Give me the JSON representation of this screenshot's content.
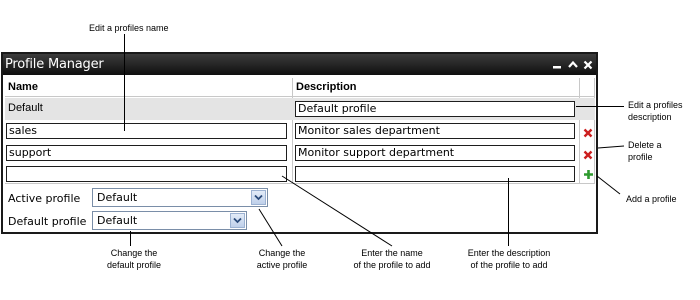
{
  "annotations": {
    "edit_name": "Edit a profiles name",
    "edit_desc_1": "Edit a profiles",
    "edit_desc_2": "description",
    "delete_1": "Delete a",
    "delete_2": "profile",
    "add": "Add a profile",
    "change_default_1": "Change the",
    "change_default_2": "default profile",
    "change_active_1": "Change the",
    "change_active_2": "active profile",
    "enter_name_1": "Enter the name",
    "enter_name_2": "of the profile to add",
    "enter_desc_1": "Enter the description",
    "enter_desc_2": "of the profile to add"
  },
  "window": {
    "title": "Profile Manager",
    "minimize_icon": "minimize-icon",
    "maximize_icon": "chevron-up-icon",
    "close_icon": "close-icon"
  },
  "table": {
    "headers": {
      "name": "Name",
      "description": "Description"
    },
    "rows": [
      {
        "name": "Default",
        "description": "Default profile",
        "editable_name": false,
        "deletable": false
      },
      {
        "name": "sales",
        "description": "Monitor sales department",
        "editable_name": true,
        "deletable": true
      },
      {
        "name": "support",
        "description": "Monitor support department",
        "editable_name": true,
        "deletable": true
      }
    ],
    "new_row": {
      "name": "",
      "description": ""
    }
  },
  "settings": {
    "active_label": "Active profile",
    "active_value": "Default",
    "default_label": "Default profile",
    "default_value": "Default"
  },
  "colors": {
    "delete": "#cc1f1f",
    "add": "#2e9a2e",
    "selected_row": "#e4e4e4",
    "titlebar": "#1a1a1a"
  }
}
